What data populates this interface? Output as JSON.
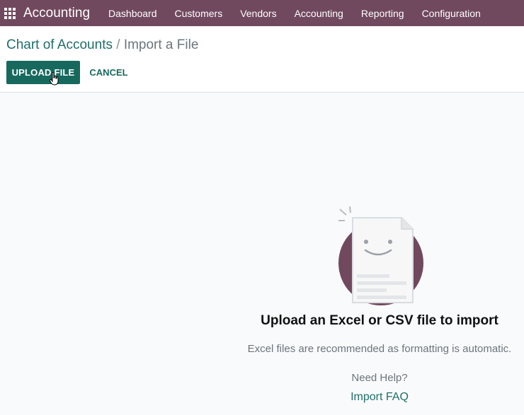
{
  "navbar": {
    "app_name": "Accounting",
    "menu": [
      "Dashboard",
      "Customers",
      "Vendors",
      "Accounting",
      "Reporting",
      "Configuration"
    ]
  },
  "breadcrumb": {
    "parent": "Chart of Accounts",
    "separator": "/",
    "current": "Import a File"
  },
  "actions": {
    "upload_label": "UPLOAD FILE",
    "cancel_label": "CANCEL"
  },
  "empty_state": {
    "title": "Upload an Excel or CSV file to import",
    "description": "Excel files are recommended as formatting is automatic.",
    "help_text": "Need Help?",
    "faq_link": "Import FAQ"
  },
  "colors": {
    "navbar": "#71495f",
    "primary": "#17695e",
    "illustration_circle": "#71495f"
  },
  "icons": [
    "apps-grid-icon",
    "pointer-cursor-icon",
    "file-illustration-icon"
  ]
}
